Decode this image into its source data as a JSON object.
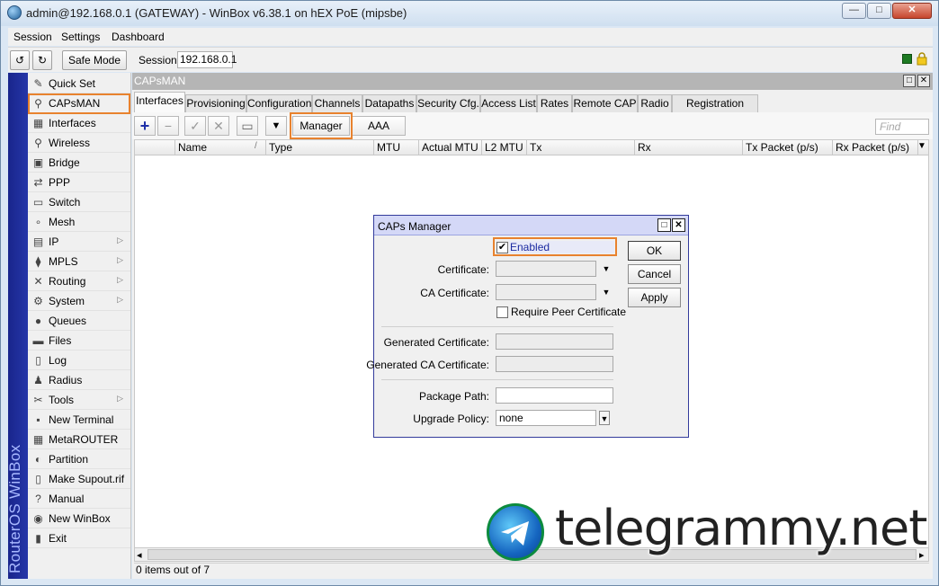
{
  "window": {
    "title": "admin@192.168.0.1 (GATEWAY) - WinBox v6.38.1 on hEX PoE (mipsbe)",
    "minimize_glyph": "—",
    "maximize_glyph": "□",
    "close_glyph": "✕"
  },
  "menubar": {
    "items": [
      "Session",
      "Settings",
      "Dashboard"
    ]
  },
  "toolbar": {
    "undo_glyph": "↺",
    "redo_glyph": "↻",
    "safe_mode_label": "Safe Mode",
    "session_label": "Session:",
    "session_value": "192.168.0.1"
  },
  "vertical_brand": "RouterOS WinBox",
  "sidebar": {
    "items": [
      {
        "label": "Quick Set",
        "icon": "quick-set-icon",
        "glyph": "✎"
      },
      {
        "label": "CAPsMAN",
        "icon": "capsman-icon",
        "glyph": "⚲",
        "highlighted": true
      },
      {
        "label": "Interfaces",
        "icon": "interfaces-icon",
        "glyph": "▦"
      },
      {
        "label": "Wireless",
        "icon": "wireless-icon",
        "glyph": "⚲"
      },
      {
        "label": "Bridge",
        "icon": "bridge-icon",
        "glyph": "▣"
      },
      {
        "label": "PPP",
        "icon": "ppp-icon",
        "glyph": "⇄"
      },
      {
        "label": "Switch",
        "icon": "switch-icon",
        "glyph": "▭"
      },
      {
        "label": "Mesh",
        "icon": "mesh-icon",
        "glyph": "∘"
      },
      {
        "label": "IP",
        "icon": "ip-icon",
        "glyph": "▤",
        "submenu": true
      },
      {
        "label": "MPLS",
        "icon": "mpls-icon",
        "glyph": "⧫",
        "submenu": true
      },
      {
        "label": "Routing",
        "icon": "routing-icon",
        "glyph": "✕",
        "submenu": true
      },
      {
        "label": "System",
        "icon": "system-icon",
        "glyph": "⚙",
        "submenu": true
      },
      {
        "label": "Queues",
        "icon": "queues-icon",
        "glyph": "●"
      },
      {
        "label": "Files",
        "icon": "files-icon",
        "glyph": "▬"
      },
      {
        "label": "Log",
        "icon": "log-icon",
        "glyph": "▯"
      },
      {
        "label": "Radius",
        "icon": "radius-icon",
        "glyph": "♟"
      },
      {
        "label": "Tools",
        "icon": "tools-icon",
        "glyph": "✂",
        "submenu": true
      },
      {
        "label": "New Terminal",
        "icon": "terminal-icon",
        "glyph": "▪"
      },
      {
        "label": "MetaROUTER",
        "icon": "metarouter-icon",
        "glyph": "▦"
      },
      {
        "label": "Partition",
        "icon": "partition-icon",
        "glyph": "◐"
      },
      {
        "label": "Make Supout.rif",
        "icon": "supout-icon",
        "glyph": "▯"
      },
      {
        "label": "Manual",
        "icon": "manual-icon",
        "glyph": "?"
      },
      {
        "label": "New WinBox",
        "icon": "new-winbox-icon",
        "glyph": "◉"
      },
      {
        "label": "Exit",
        "icon": "exit-icon",
        "glyph": "▮"
      }
    ],
    "submenu_glyph": "▷"
  },
  "capsman": {
    "title": "CAPsMAN",
    "tabs": [
      "Interfaces",
      "Provisioning",
      "Configurations",
      "Channels",
      "Datapaths",
      "Security Cfg.",
      "Access List",
      "Rates",
      "Remote CAP",
      "Radio",
      "Registration Table"
    ],
    "active_tab": "Interfaces",
    "tool_glyphs": {
      "add": "+",
      "remove": "−",
      "enable": "✓",
      "disable": "✕",
      "comment": "▭",
      "filter": "▼"
    },
    "manager_label": "Manager",
    "aaa_label": "AAA",
    "find_placeholder": "Find",
    "columns": [
      "",
      "Name",
      "Type",
      "MTU",
      "Actual MTU",
      "L2 MTU",
      "Tx",
      "Rx",
      "Tx Packet (p/s)",
      "Rx Packet (p/s)"
    ],
    "sort_indicator": "/",
    "column_menu_glyph": "▼",
    "status": "0 items out of 7",
    "scroll_left_glyph": "◂",
    "scroll_right_glyph": "▸"
  },
  "dialog": {
    "title": "CAPs Manager",
    "enabled_label": "Enabled",
    "enabled_checked": true,
    "check_glyph": "✔",
    "certificate_label": "Certificate:",
    "certificate_value": "",
    "ca_certificate_label": "CA Certificate:",
    "ca_certificate_value": "",
    "require_peer_label": "Require Peer Certificate",
    "require_peer_checked": false,
    "generated_cert_label": "Generated Certificate:",
    "generated_ca_cert_label": "Generated CA Certificate:",
    "package_path_label": "Package Path:",
    "package_path_value": "",
    "upgrade_policy_label": "Upgrade Policy:",
    "upgrade_policy_value": "none",
    "ok_label": "OK",
    "cancel_label": "Cancel",
    "apply_label": "Apply"
  },
  "watermark": {
    "text": "telegrammy.net"
  },
  "colors": {
    "highlight": "#e8822e",
    "sidebar_brand_bg": "#1f2d9b",
    "dialog_border": "#333b9b"
  }
}
